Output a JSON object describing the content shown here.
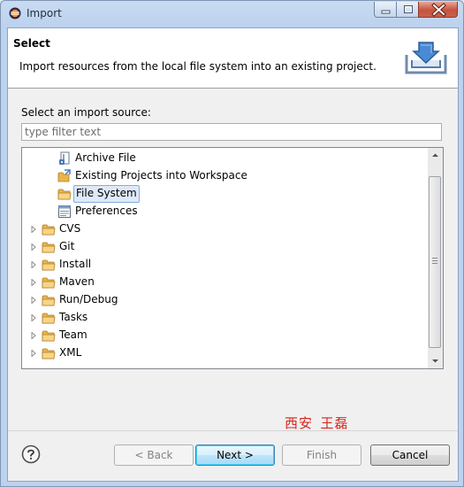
{
  "window": {
    "title": "Import"
  },
  "header": {
    "title": "Select",
    "description": "Import resources from the local file system into an existing project."
  },
  "source": {
    "label": "Select an import source:",
    "filter_placeholder": "type filter text",
    "filter_value": ""
  },
  "tree": {
    "items": [
      {
        "label": "Archive File",
        "icon": "archive-file-icon",
        "level": 1,
        "expandable": false,
        "selected": false
      },
      {
        "label": "Existing Projects into Workspace",
        "icon": "existing-projects-icon",
        "level": 1,
        "expandable": false,
        "selected": false
      },
      {
        "label": "File System",
        "icon": "folder-icon",
        "level": 1,
        "expandable": false,
        "selected": true
      },
      {
        "label": "Preferences",
        "icon": "preferences-icon",
        "level": 1,
        "expandable": false,
        "selected": false
      },
      {
        "label": "CVS",
        "icon": "folder-icon",
        "level": 0,
        "expandable": true,
        "selected": false
      },
      {
        "label": "Git",
        "icon": "folder-icon",
        "level": 0,
        "expandable": true,
        "selected": false
      },
      {
        "label": "Install",
        "icon": "folder-icon",
        "level": 0,
        "expandable": true,
        "selected": false
      },
      {
        "label": "Maven",
        "icon": "folder-icon",
        "level": 0,
        "expandable": true,
        "selected": false
      },
      {
        "label": "Run/Debug",
        "icon": "folder-icon",
        "level": 0,
        "expandable": true,
        "selected": false
      },
      {
        "label": "Tasks",
        "icon": "folder-icon",
        "level": 0,
        "expandable": true,
        "selected": false
      },
      {
        "label": "Team",
        "icon": "folder-icon",
        "level": 0,
        "expandable": true,
        "selected": false
      },
      {
        "label": "XML",
        "icon": "folder-icon",
        "level": 0,
        "expandable": true,
        "selected": false
      }
    ]
  },
  "watermark": "西安_王磊",
  "buttons": {
    "back": "< Back",
    "next": "Next >",
    "finish": "Finish",
    "cancel": "Cancel"
  },
  "colors": {
    "selection_fill": "#dfe9f8",
    "selection_border": "#84acdd",
    "watermark": "#d8241c",
    "folder": "#e8b54b"
  }
}
